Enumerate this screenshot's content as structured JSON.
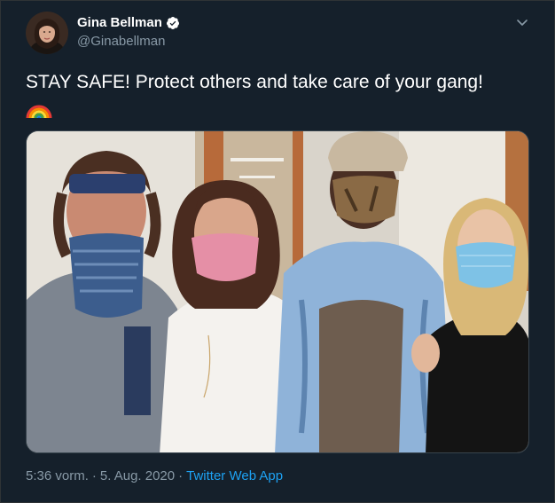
{
  "user": {
    "display_name": "Gina Bellman",
    "handle": "@Ginabellman",
    "verified_icon": "verified-badge-icon",
    "avatar_icon": "profile-avatar"
  },
  "tweet": {
    "text": "STAY SAFE! Protect others and take care of your gang!",
    "emoji_icon": "rainbow-emoji-icon"
  },
  "meta": {
    "time": "5:36 vorm.",
    "separator1": "·",
    "date": "5. Aug. 2020",
    "separator2": "·",
    "source": "Twitter Web App"
  },
  "colors": {
    "background": "#15202b",
    "secondary_text": "#8899a6",
    "link": "#1da1f2",
    "verified": "#ffffff"
  }
}
